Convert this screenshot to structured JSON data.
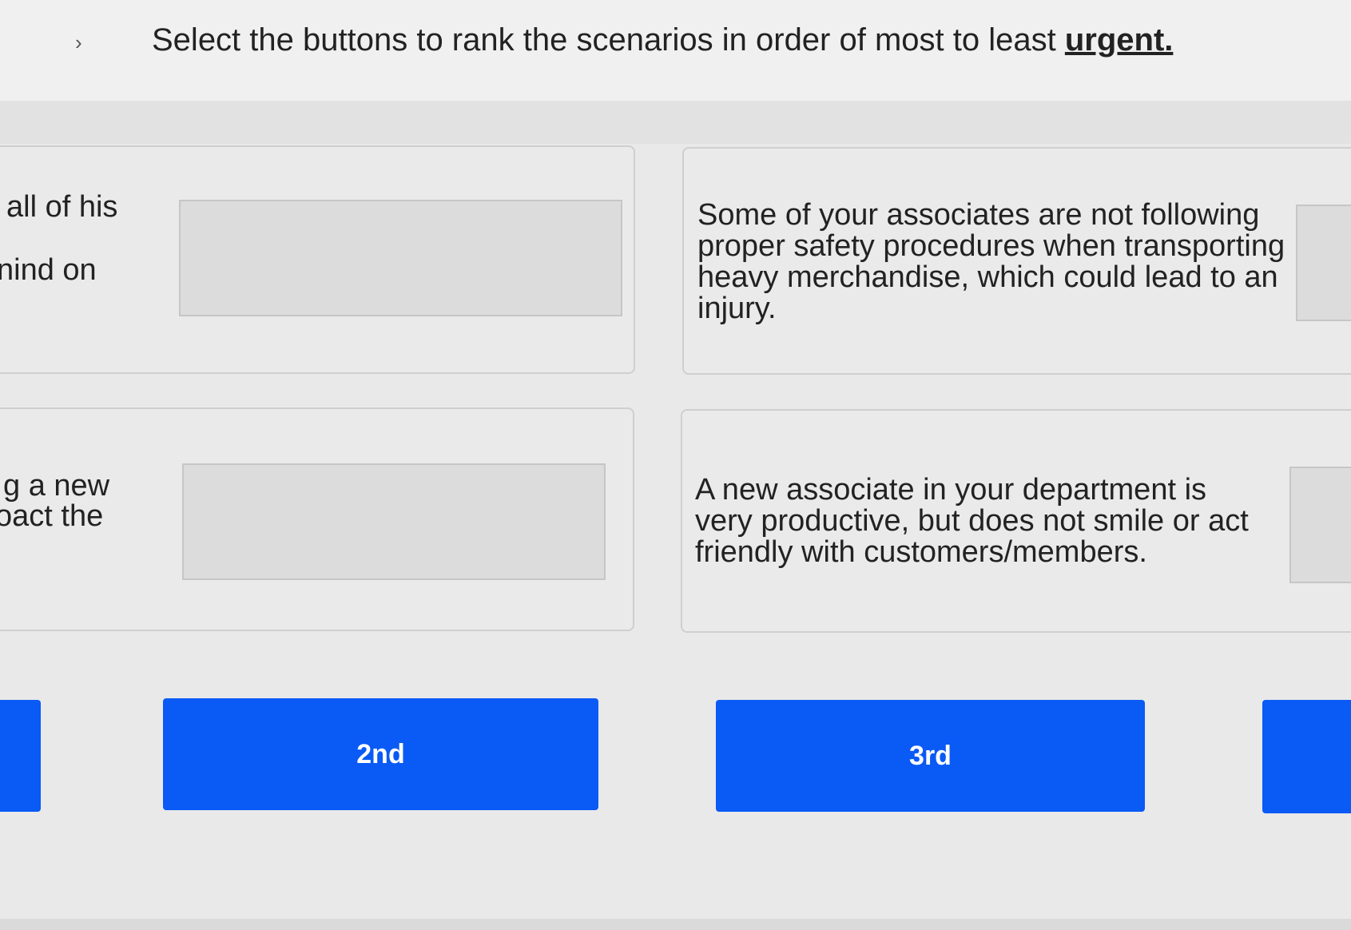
{
  "header": {
    "instruction_text": "Select the buttons to rank the scenarios in order of most to least",
    "instruction_emphasis": "urgent."
  },
  "scenarios": [
    {
      "partial_lines": [
        "all of his",
        "nind on"
      ]
    },
    {
      "text": "Some of your associates are not following proper safety procedures when transporting heavy merchandise, which could lead to an injury."
    },
    {
      "partial_lines": [
        "g a new",
        "oact the"
      ]
    },
    {
      "text": "A new associate in your department is very productive, but does not smile or act friendly with customers/members."
    }
  ],
  "rank_buttons": [
    {
      "label": ""
    },
    {
      "label": "2nd"
    },
    {
      "label": "3rd"
    },
    {
      "label": ""
    }
  ],
  "colors": {
    "button_blue": "#0a5af5",
    "page_background": "#e9e9e9",
    "slot_gray": "#dcdcdc"
  }
}
